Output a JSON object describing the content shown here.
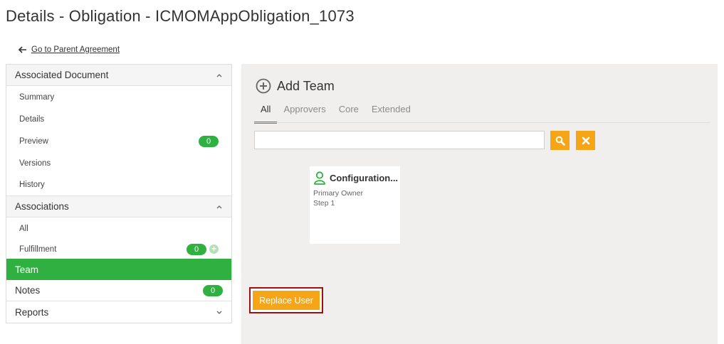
{
  "page": {
    "title": "Details - Obligation - ICMOMAppObligation_1073"
  },
  "nav": {
    "back_label": "Go to Parent Agreement"
  },
  "sidebar": {
    "associated_document": {
      "label": "Associated Document",
      "items": [
        {
          "label": "Summary"
        },
        {
          "label": "Details"
        },
        {
          "label": "Preview",
          "count": "0"
        },
        {
          "label": "Versions"
        },
        {
          "label": "History"
        }
      ]
    },
    "associations": {
      "label": "Associations",
      "items": [
        {
          "label": "All"
        },
        {
          "label": "Fulfillment",
          "count": "0"
        }
      ]
    },
    "team": {
      "label": "Team"
    },
    "notes": {
      "label": "Notes",
      "count": "0"
    },
    "reports": {
      "label": "Reports"
    }
  },
  "main": {
    "add_team_label": "Add Team",
    "tabs": [
      {
        "label": "All",
        "selected": true
      },
      {
        "label": "Approvers"
      },
      {
        "label": "Core"
      },
      {
        "label": "Extended"
      }
    ],
    "search": {
      "value": "",
      "placeholder": ""
    },
    "card": {
      "name": "Configuration...",
      "role": "Primary Owner",
      "step": "Step 1"
    },
    "replace_user_label": "Replace User"
  },
  "colors": {
    "accent_green": "#2fb040",
    "accent_orange": "#f5a515",
    "highlight_border": "#a01010"
  },
  "icons": [
    "back-arrow-icon",
    "chevron-up-icon",
    "chevron-down-icon",
    "add-circle-icon",
    "search-icon",
    "close-icon",
    "user-icon",
    "plus-circle-icon"
  ]
}
